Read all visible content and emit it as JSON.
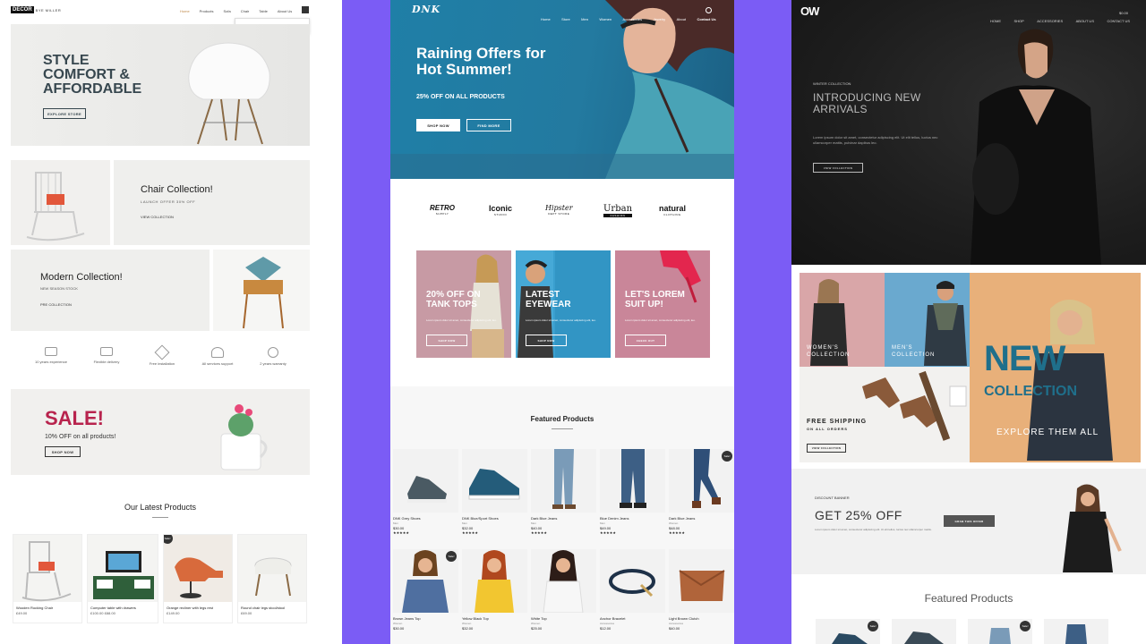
{
  "panel1": {
    "brand": {
      "top": "DECOR",
      "bottom_right": "BYE MILLER"
    },
    "nav": [
      "Home",
      "Products",
      "Sofa",
      "Chair",
      "Table",
      "About Us"
    ],
    "search_placeholder": "Key product & Enter...",
    "hero": {
      "title": [
        "STYLE",
        "COMFORT &",
        "AFFORDABLE"
      ],
      "button": "EXPLORE STORE"
    },
    "chair_collection": {
      "title": "Chair Collection!",
      "sub": "LAUNCH OFFER 30% OFF",
      "link": "VIEW COLLECTION"
    },
    "modern_collection": {
      "title": "Modern Collection!",
      "sub": "NEW SEASON STOCK",
      "link": "PRE COLLECTION"
    },
    "features": [
      "10 years experience",
      "Flexible delivery",
      "Free installation",
      "All services support",
      "2 years warranty"
    ],
    "sale": {
      "title": "SALE!",
      "sub": "10% OFF on all products!",
      "button": "SHOP NOW"
    },
    "latest": {
      "heading": "Our Latest Products",
      "products": [
        {
          "name": "Wooden Rocking Chair",
          "price": "£49.00"
        },
        {
          "name": "Computer table with drawers",
          "price": "£100.00 £88.00"
        },
        {
          "name": "Orange recliner with legs rest",
          "price": "£149.00"
        },
        {
          "name": "Round chair legs stool/stool",
          "price": "£69.00"
        }
      ]
    }
  },
  "panel2": {
    "logo": "DNK",
    "nav": [
      "Home",
      "Store",
      "Men",
      "Women",
      "Accessories",
      "Jewelry",
      "About",
      "Contact Us"
    ],
    "hero": {
      "title": [
        "Raining Offers for",
        "Hot Summer!"
      ],
      "sub": "25% OFF ON ALL PRODUCTS",
      "btn1": "SHOP NOW",
      "btn2": "FIND MORE"
    },
    "brands": [
      {
        "name": "RETRO",
        "sub": "SUPPLY"
      },
      {
        "name": "Iconic",
        "sub": "STUDIO"
      },
      {
        "name": "Hipster",
        "sub": "DEPT STORE"
      },
      {
        "name": "Urban",
        "sub": "FASHION"
      },
      {
        "name": "natural",
        "sub": "CLOTHING"
      }
    ],
    "promos": [
      {
        "title": [
          "20% OFF ON",
          "TANK TOPS"
        ],
        "sub": "Lorem ipsum dolor sit amet, consectetur adipiscing elit, leo.",
        "btn": "SHOP NOW",
        "color": "#c79aa4"
      },
      {
        "title": [
          "LATEST",
          "EYEWEAR"
        ],
        "sub": "Lorem ipsum dolor sit amet, consectetur adipiscing elit, leo.",
        "btn": "SHOP NOW",
        "color": "#3a9fcf"
      },
      {
        "title": [
          "LET'S LOREM",
          "SUIT UP!"
        ],
        "sub": "Lorem ipsum dolor sit amet, consectetur adipiscing elit, leo.",
        "btn": "CHECK OUT",
        "color": "#c98699"
      }
    ],
    "featured_heading": "Featured Products",
    "products": [
      {
        "name": "DNK Grey Shoes",
        "cat": "Men",
        "price": "$30.00",
        "sale": false
      },
      {
        "name": "DNK Blue/Sport Shoes",
        "cat": "Men",
        "price": "$32.00",
        "sale": false
      },
      {
        "name": "Dark Blue Jeans",
        "cat": "Men",
        "price": "$40.00",
        "sale": false
      },
      {
        "name": "Blue Denim Jeans",
        "cat": "Men",
        "price": "$49.00",
        "sale": false
      },
      {
        "name": "Dark Blue Jeans",
        "cat": "Women",
        "price": "$48.00",
        "sale": true
      },
      {
        "name": "Brown Jeans Top",
        "cat": "Women",
        "price": "$30.00",
        "sale": true
      },
      {
        "name": "Yellow Black Top",
        "cat": "Women",
        "price": "$32.00",
        "sale": false
      },
      {
        "name": "White Top",
        "cat": "Women",
        "price": "$25.00",
        "sale": false
      },
      {
        "name": "Anchor Bracelet",
        "cat": "Accessories",
        "price": "$12.00",
        "sale": false
      },
      {
        "name": "Light Brown Clutch",
        "cat": "Accessories",
        "price": "$40.00",
        "sale": false
      }
    ],
    "sale_label": "Sale!",
    "stars": "★★★★★"
  },
  "panel3": {
    "logo": "OW",
    "nav": [
      "HOME",
      "SHOP",
      "ACCESSORIES",
      "ABOUT US",
      "CONTACT US"
    ],
    "cart": "$0.00",
    "hero": {
      "kicker": "WINTER COLLECTION",
      "title": [
        "INTRODUCING NEW",
        "ARRIVALS"
      ],
      "body": "Lorem ipsum dolor sit amet, consectetur adipiscing elit. Ut elit tellus, luctus nec ullamcorper mattis, pulvinar dapibus leo.",
      "button": "VIEW COLLECTION"
    },
    "tiles": {
      "women": [
        "WOMEN'S",
        "COLLECTION"
      ],
      "men": [
        "MEN'S",
        "COLLECTION"
      ],
      "shipping": [
        "FREE SHIPPING",
        "ON ALL ORDERS"
      ],
      "shipping_btn": "VIEW COLLECTION",
      "new": [
        "NEW",
        "COLLECTION"
      ],
      "explore": "EXPLORE THEM ALL"
    },
    "discount": {
      "kicker": "DISCOUNT BANNER",
      "title": "GET 25% OFF",
      "body": "Lorem ipsum dolor sit amet, consectetur adipiscing elit. Ut elit tellus, luctus nec ullamcorper mattis.",
      "button": "GRAB THIS OFFER"
    },
    "featured_heading": "Featured Products"
  }
}
